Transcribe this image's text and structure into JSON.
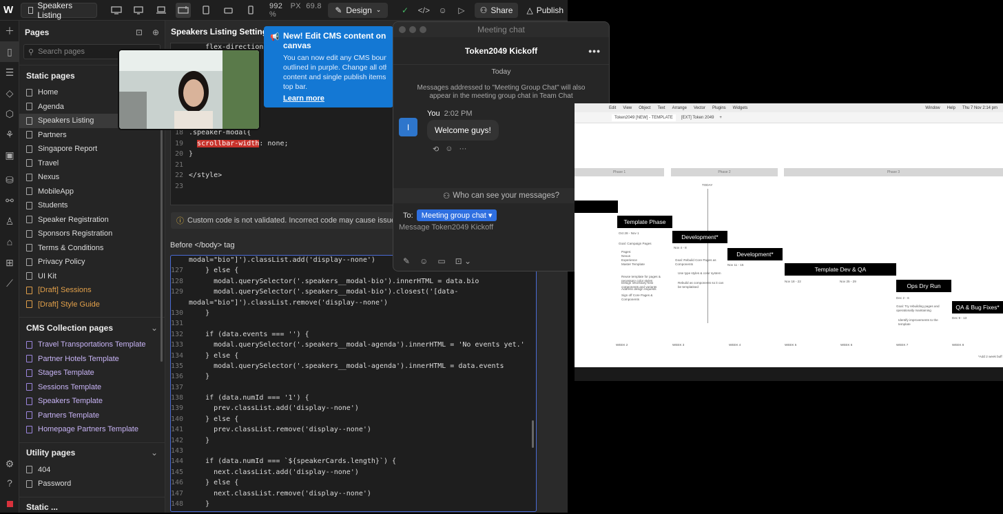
{
  "topbar": {
    "logo": "W",
    "page_name": "Speakers Listing",
    "width_value": "992",
    "width_unit": "PX",
    "zoom": "69.8 %",
    "mode": "Design",
    "share": "Share",
    "publish": "Publish"
  },
  "pages_panel": {
    "title": "Pages",
    "search_placeholder": "Search pages",
    "static_title": "Static pages",
    "static_pages": [
      "Home",
      "Agenda",
      "Speakers Listing",
      "Partners",
      "Singapore Report",
      "Travel",
      "Nexus",
      "MobileApp",
      "Students",
      "Speaker Registration",
      "Sponsors Registration",
      "Terms & Conditions",
      "Privacy Policy",
      "UI Kit"
    ],
    "draft_pages": [
      "[Draft] Sessions",
      "[Draft] Style Guide"
    ],
    "cms_title": "CMS Collection pages",
    "cms_pages": [
      "Travel Transportations Template",
      "Partner Hotels Template",
      "Stages Template",
      "Sessions Template",
      "Speakers Template",
      "Partners Template",
      "Homepage Partners Template"
    ],
    "utility_title": "Utility pages",
    "utility_pages": [
      "404",
      "Password"
    ],
    "more_title": "Static ..."
  },
  "settings": {
    "title": "Speakers Listing Settings",
    "warning": "Custom code is not validated. Incorrect code may cause issues wi",
    "before_body_label": "Before </body> tag"
  },
  "code_head": [
    {
      "n": "",
      "t": "    flex-direction"
    },
    {
      "n": "",
      "t": ""
    },
    {
      "n": "",
      "t": ""
    },
    {
      "n": "",
      "t": ""
    },
    {
      "n": "",
      "t": ""
    },
    {
      "n": "",
      "t": ""
    },
    {
      "n": "",
      "t": ""
    },
    {
      "n": "",
      "t": ""
    },
    {
      "n": "18",
      "t": ".speaker-modal{"
    },
    {
      "n": "19",
      "t": "  scrollbar-width: none;"
    },
    {
      "n": "20",
      "t": "}"
    },
    {
      "n": "21",
      "t": ""
    },
    {
      "n": "22",
      "t": "</style>"
    },
    {
      "n": "23",
      "t": ""
    }
  ],
  "code_body": [
    {
      "n": "",
      "t": "modal=\"bio\"]').classList.add('display--none')"
    },
    {
      "n": "127",
      "t": "    } else {"
    },
    {
      "n": "128",
      "t": "      modal.querySelector('.speakers__modal-bio').innerHTML = data.bio"
    },
    {
      "n": "129",
      "t": "      modal.querySelector('.speakers__modal-bio').closest('[data-"
    },
    {
      "n": "",
      "t": "modal=\"bio\"]').classList.remove('display--none')"
    },
    {
      "n": "130",
      "t": "    }"
    },
    {
      "n": "131",
      "t": ""
    },
    {
      "n": "132",
      "t": "    if (data.events === '') {"
    },
    {
      "n": "133",
      "t": "      modal.querySelector('.speakers__modal-agenda').innerHTML = 'No events yet.'"
    },
    {
      "n": "134",
      "t": "    } else {"
    },
    {
      "n": "135",
      "t": "      modal.querySelector('.speakers__modal-agenda').innerHTML = data.events"
    },
    {
      "n": "136",
      "t": "    }"
    },
    {
      "n": "137",
      "t": ""
    },
    {
      "n": "138",
      "t": "    if (data.numId === '1') {"
    },
    {
      "n": "139",
      "t": "      prev.classList.add('display--none')"
    },
    {
      "n": "140",
      "t": "    } else {"
    },
    {
      "n": "141",
      "t": "      prev.classList.remove('display--none')"
    },
    {
      "n": "142",
      "t": "    }"
    },
    {
      "n": "143",
      "t": ""
    },
    {
      "n": "144",
      "t": "    if (data.numId === `${speakerCards.length}`) {"
    },
    {
      "n": "145",
      "t": "      next.classList.add('display--none')"
    },
    {
      "n": "146",
      "t": "    } else {"
    },
    {
      "n": "147",
      "t": "      next.classList.remove('display--none')"
    },
    {
      "n": "148",
      "t": "    }"
    }
  ],
  "cms_popup": {
    "title": "New! Edit CMS content on canvas",
    "body": [
      "You can now edit any CMS bound t",
      "outlined in purple. Change all other",
      "content and single publish items vi",
      "top bar."
    ],
    "link": "Learn more"
  },
  "chat": {
    "window_title": "Meeting chat",
    "header": "Token2049 Kickoff",
    "day": "Today",
    "note": "Messages addressed to \"Meeting Group Chat\" will also appear in the meeting group chat in Team Chat",
    "avatar_initial": "I",
    "sender": "You",
    "time": "2:02 PM",
    "message": "Welcome guys!",
    "visibility": "Who can see your messages?",
    "to_label": "To:",
    "recipient": "Meeting group chat",
    "placeholder": "Message Token2049 Kickoff"
  },
  "shared_screen": {
    "menu": [
      "Edit",
      "View",
      "Object",
      "Text",
      "Arrange",
      "Vector",
      "Plugins",
      "Widgets"
    ],
    "menu_right": [
      "Window",
      "Help"
    ],
    "clock": "Thu 7 Nov  2:14 pm",
    "tab1": "Token2049 [NEW] - TEMPLATE",
    "tab2": "[EXT] Token 2049",
    "phases": [
      "Phase 1",
      "Phase 2",
      "Phase 3"
    ],
    "today_label": "TODAY",
    "blocks": [
      "Template Phase",
      "Development*",
      "Development*",
      "Template Dev & QA",
      "Ops Dry Run",
      "QA & Bug Fixes*"
    ],
    "dates": [
      "Oct 28 - Nov 1",
      "Nov 4 - 8",
      "Nov 11 - 15",
      "Nov 18 - 22",
      "Nov 25 - 29",
      "Dec 2 - 6",
      "Dec 9 - 13"
    ],
    "weeks": [
      "WEEK 2",
      "WEEK 3",
      "WEEK 4",
      "WEEK 5",
      "WEEK 6",
      "WEEK 7",
      "WEEK 8"
    ],
    "goal1": "Goal: Campaign Pages",
    "goal1_items": [
      "Pages:",
      "Nexus",
      "Experience",
      "Master Template",
      "Reuse template for pages & necessary color styles",
      "Design necessary new components and variants",
      "Address design requests",
      "Sign off Core Pages & Components"
    ],
    "goal2": "Goal: Rebuild Core Pages as Components",
    "goal2_items": [
      "Use type styles & color system",
      "Rebuild as components so it can be templatised"
    ],
    "goal3": "Goal: Try rebuilding pages and operationally maintaining",
    "goal3_items": [
      "Identify improvements to the template"
    ],
    "footnote": "*Add 2 week buff"
  }
}
